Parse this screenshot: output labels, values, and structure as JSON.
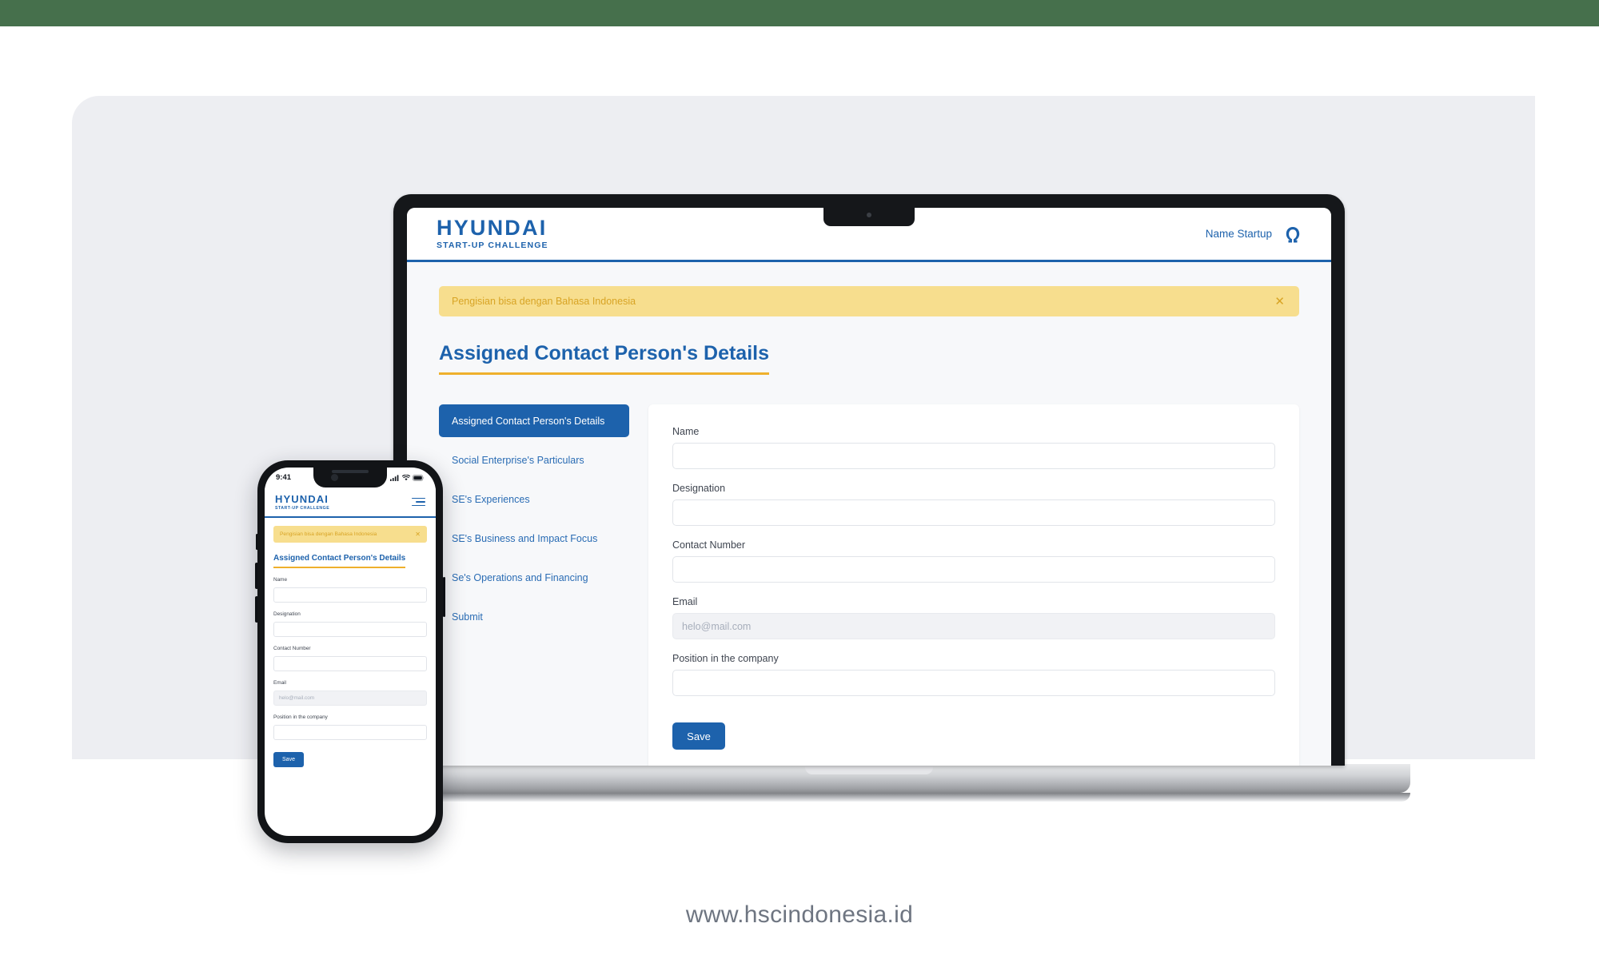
{
  "theme": {
    "green_band": "#46704C",
    "panel_bg": "#EDEEF2",
    "brand_blue": "#1D62AC",
    "accent_yellow": "#EFB02C",
    "alert_bg": "#F7DE8E",
    "alert_text": "#D8A425"
  },
  "site": {
    "brand": {
      "name": "HYUNDAI",
      "subtitle": "START-UP CHALLENGE"
    },
    "header": {
      "startup_label": "Name Startup",
      "avatar_icon": "omega-avatar-icon"
    },
    "alert": {
      "message": "Pengisian bisa dengan Bahasa Indonesia",
      "close_icon": "close-icon"
    },
    "page_title": "Assigned Contact Person's Details",
    "nav_items": [
      {
        "label": "Assigned Contact Person's Details",
        "active": true
      },
      {
        "label": "Social Enterprise's Particulars",
        "active": false
      },
      {
        "label": "SE's Experiences",
        "active": false
      },
      {
        "label": "SE's Business and Impact Focus",
        "active": false
      },
      {
        "label": "Se's Operations and Financing",
        "active": false
      },
      {
        "label": "Submit",
        "active": false
      }
    ],
    "form": {
      "fields": [
        {
          "label": "Name",
          "value": "",
          "placeholder": "",
          "muted": false
        },
        {
          "label": "Designation",
          "value": "",
          "placeholder": "",
          "muted": false
        },
        {
          "label": "Contact Number",
          "value": "",
          "placeholder": "",
          "muted": false
        },
        {
          "label": "Email",
          "value": "",
          "placeholder": "helo@mail.com",
          "muted": true
        },
        {
          "label": "Position in the company",
          "value": "",
          "placeholder": "",
          "muted": false
        }
      ],
      "save_label": "Save"
    }
  },
  "phone": {
    "status": {
      "time": "9:41",
      "signal_icon": "cellular-signal-icon",
      "wifi_icon": "wifi-icon",
      "battery_icon": "battery-icon"
    },
    "menu_icon": "hamburger-menu-icon"
  },
  "footer": {
    "url": "www.hscindonesia.id"
  }
}
